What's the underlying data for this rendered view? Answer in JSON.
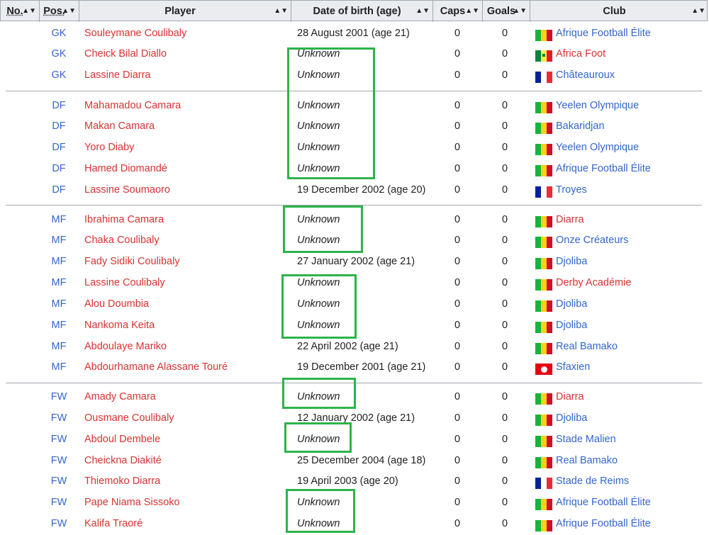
{
  "headers": {
    "no": "No.",
    "pos": "Pos.",
    "player": "Player",
    "dob": "Date of birth (age)",
    "caps": "Caps",
    "goals": "Goals",
    "club": "Club",
    "sort_icon": "sort-arrows-icon"
  },
  "colors": {
    "link_blue": "#3366cc",
    "link_red": "#d73333",
    "header_bg": "#eaecf0",
    "highlight_green": "#2db34a"
  },
  "rows": [
    {
      "pos": "GK",
      "player": "Souleymane Coulibaly",
      "dob": "28 August 2001 (age 21)",
      "caps": "0",
      "goals": "0",
      "club": "Afrique Football Élite",
      "flag": "mali"
    },
    {
      "pos": "GK",
      "player": "Cheick Bilal Diallo",
      "dob": "Unknown",
      "caps": "0",
      "goals": "0",
      "club": "Africa Foot",
      "flag": "senegal",
      "club_red": true
    },
    {
      "pos": "GK",
      "player": "Lassine Diarra",
      "dob": "Unknown",
      "caps": "0",
      "goals": "0",
      "club": "Châteauroux",
      "flag": "france"
    },
    {
      "pos": "DF",
      "player": "Mahamadou Camara",
      "dob": "Unknown",
      "caps": "0",
      "goals": "0",
      "club": "Yeelen Olympique",
      "flag": "mali"
    },
    {
      "pos": "DF",
      "player": "Makan Camara",
      "dob": "Unknown",
      "caps": "0",
      "goals": "0",
      "club": "Bakaridjan",
      "flag": "mali"
    },
    {
      "pos": "DF",
      "player": "Yoro Diaby",
      "dob": "Unknown",
      "caps": "0",
      "goals": "0",
      "club": "Yeelen Olympique",
      "flag": "mali"
    },
    {
      "pos": "DF",
      "player": "Hamed Diomandé",
      "dob": "Unknown",
      "caps": "0",
      "goals": "0",
      "club": "Afrique Football Élite",
      "flag": "mali"
    },
    {
      "pos": "DF",
      "player": "Lassine Soumaoro",
      "dob": "19 December 2002 (age 20)",
      "caps": "0",
      "goals": "0",
      "club": "Troyes",
      "flag": "france"
    },
    {
      "pos": "MF",
      "player": "Ibrahima Camara",
      "dob": "Unknown",
      "caps": "0",
      "goals": "0",
      "club": "Diarra",
      "flag": "mali",
      "club_red": true
    },
    {
      "pos": "MF",
      "player": "Chaka Coulibaly",
      "dob": "Unknown",
      "caps": "0",
      "goals": "0",
      "club": "Onze Créateurs",
      "flag": "mali"
    },
    {
      "pos": "MF",
      "player": "Fady Sidiki Coulibaly",
      "dob": "27 January 2002 (age 21)",
      "caps": "0",
      "goals": "0",
      "club": "Djoliba",
      "flag": "mali"
    },
    {
      "pos": "MF",
      "player": "Lassine Coulibaly",
      "dob": "Unknown",
      "caps": "0",
      "goals": "0",
      "club": "Derby Académie",
      "flag": "mali",
      "club_red": true
    },
    {
      "pos": "MF",
      "player": "Alou Doumbia",
      "dob": "Unknown",
      "caps": "0",
      "goals": "0",
      "club": "Djoliba",
      "flag": "mali"
    },
    {
      "pos": "MF",
      "player": "Nankoma Keita",
      "dob": "Unknown",
      "caps": "0",
      "goals": "0",
      "club": "Djoliba",
      "flag": "mali"
    },
    {
      "pos": "MF",
      "player": "Abdoulaye Mariko",
      "dob": "22 April 2002 (age 21)",
      "caps": "0",
      "goals": "0",
      "club": "Real Bamako",
      "flag": "mali"
    },
    {
      "pos": "MF",
      "player": "Abdourhamane Alassane Touré",
      "dob": "19 December 2001 (age 21)",
      "caps": "0",
      "goals": "0",
      "club": "Sfaxien",
      "flag": "tunisia"
    },
    {
      "pos": "FW",
      "player": "Amady Camara",
      "dob": "Unknown",
      "caps": "0",
      "goals": "0",
      "club": "Diarra",
      "flag": "mali",
      "club_red": true
    },
    {
      "pos": "FW",
      "player": "Ousmane Coulibaly",
      "dob": "12 January 2002 (age 21)",
      "caps": "0",
      "goals": "0",
      "club": "Djoliba",
      "flag": "mali"
    },
    {
      "pos": "FW",
      "player": "Abdoul Dembele",
      "dob": "Unknown",
      "caps": "0",
      "goals": "0",
      "club": "Stade Malien",
      "flag": "mali"
    },
    {
      "pos": "FW",
      "player": "Cheickna Diakité",
      "dob": "25 December 2004 (age 18)",
      "caps": "0",
      "goals": "0",
      "club": "Real Bamako",
      "flag": "mali"
    },
    {
      "pos": "FW",
      "player": "Thiemoko Diarra",
      "dob": "19 April 2003 (age 20)",
      "caps": "0",
      "goals": "0",
      "club": "Stade de Reims",
      "flag": "france"
    },
    {
      "pos": "FW",
      "player": "Pape Niama Sissoko",
      "dob": "Unknown",
      "caps": "0",
      "goals": "0",
      "club": "Afrique Football Élite",
      "flag": "mali"
    },
    {
      "pos": "FW",
      "player": "Kalifa Traoré",
      "dob": "Unknown",
      "caps": "0",
      "goals": "0",
      "club": "Afrique Football Élite",
      "flag": "mali"
    }
  ]
}
